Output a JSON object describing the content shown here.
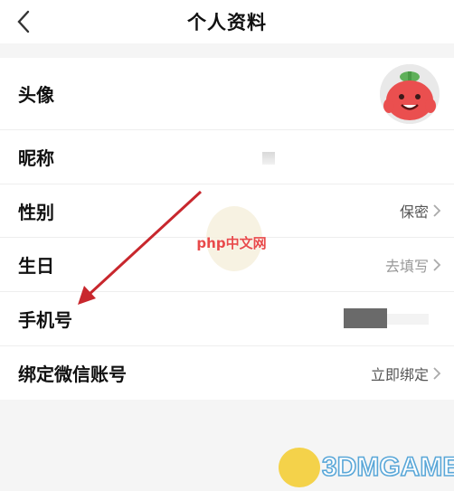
{
  "header": {
    "title": "个人资料",
    "back_icon": "chevron-left-icon"
  },
  "profile": {
    "avatar": {
      "label": "头像"
    },
    "nickname": {
      "label": "昵称",
      "value": ""
    },
    "gender": {
      "label": "性别",
      "value": "保密"
    },
    "birthday": {
      "label": "生日",
      "value": "去填写"
    },
    "phone": {
      "label": "手机号"
    },
    "wechat": {
      "label": "绑定微信账号",
      "value": "立即绑定"
    }
  },
  "colors": {
    "accent_arrow": "#c8272d",
    "label_text": "#111111",
    "value_text": "#555555",
    "placeholder_text": "#999999"
  },
  "watermarks": {
    "php": "php中文网",
    "game": "3DMGAME"
  }
}
